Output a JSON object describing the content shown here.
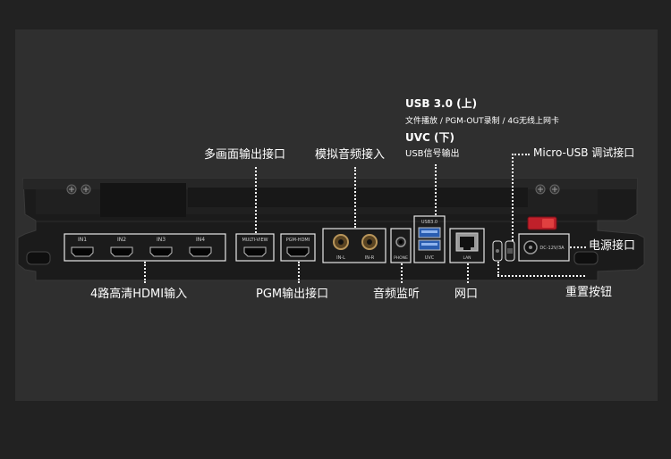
{
  "colors": {
    "background": "#222222",
    "panel": "#2f2f2f",
    "device_body": "#1a1a1a",
    "port_outline": "#e8e8e8",
    "label": "#ffffff",
    "power_switch": "#c0202a",
    "usb_blue": "#2a5db0"
  },
  "callouts": {
    "usb3_title": "USB 3.0 (上)",
    "usb3_desc": "文件播放 / PGM-OUT录制 / 4G无线上网卡",
    "uvc_title": "UVC (下)",
    "uvc_desc": "USB信号输出",
    "multiview": "多画面输出接口",
    "analog_audio": "模拟音频接入",
    "micro_usb": "Micro-USB 调试接口",
    "power": "电源接口",
    "hdmi_inputs": "4路高清HDMI输入",
    "pgm_out": "PGM输出接口",
    "audio_monitor": "音频监听",
    "network": "网口",
    "reset": "重置按钮"
  },
  "port_labels": {
    "hdmi_in": [
      "IN1",
      "IN2",
      "IN3",
      "IN4"
    ],
    "multiview": "MULTI-VIEW",
    "pgm_hdmi": "PGM-HDMI",
    "audio_in_l": "IN-L",
    "audio_in_r": "IN-R",
    "phone": "PHONE",
    "usb30": "USB3.0",
    "uvc": "UVC",
    "lan": "LAN",
    "power": "DC-12V/3A"
  },
  "icons": [
    "screw-icon",
    "hdmi-port-icon",
    "audio-jack-icon",
    "usb-port-icon",
    "ethernet-port-icon",
    "power-switch-icon",
    "dc-jack-icon"
  ]
}
